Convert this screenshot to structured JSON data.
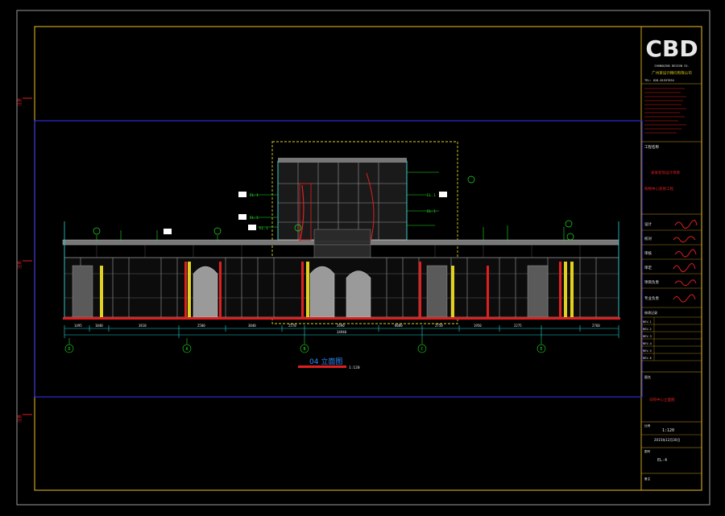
{
  "drawing": {
    "title": "04 立面图",
    "scale_label": "1:120",
    "dims": [
      "1495",
      "1040",
      "3810",
      "2500",
      "3040",
      "2570",
      "2690",
      "8080",
      "2750",
      "1950",
      "2275",
      "2760"
    ],
    "total_dim": "34940",
    "axes": [
      "D",
      "A",
      "B",
      "C",
      "E"
    ],
    "ann_left": [
      "EL.1",
      "EL.1",
      "EL.1"
    ],
    "ann_right": [
      "EL.1",
      "EL.1"
    ]
  },
  "title_block": {
    "logo_text": "CBD",
    "company_en": "CHONGQING DESIGN CO.",
    "company_cn": "广州某设计顾问有限公司",
    "tel": "TEL: 020-81557654",
    "project_label": "工程名称",
    "project_name_1": "某某装饰设计项目",
    "project_name_2": "购物中心装修工程",
    "sign_rows": [
      "设计",
      "校对",
      "审核",
      "审定",
      "项目负责",
      "专业负责"
    ],
    "rev_label": "修改记录",
    "rev_rows": [
      "REV.1",
      "REV.2",
      "REV.3",
      "REV.4",
      "REV.5",
      "REV.6"
    ],
    "sheet_label": "图名",
    "sheet_title": "日购中心立面图",
    "scale_label": "比例",
    "scale": "1:120",
    "date": "2015年12月30日",
    "sheet_no_label": "图号",
    "sheet_no": "EL-4",
    "bottom_label": "备注"
  },
  "colors": {
    "frame": "#c8a020",
    "blue": "#2b2bd8",
    "cyan": "#22d8d8",
    "green": "#20e020",
    "red": "#e02020",
    "yellow": "#e0d020",
    "gray": "#9a9a9a",
    "white": "#e8e8e8"
  }
}
